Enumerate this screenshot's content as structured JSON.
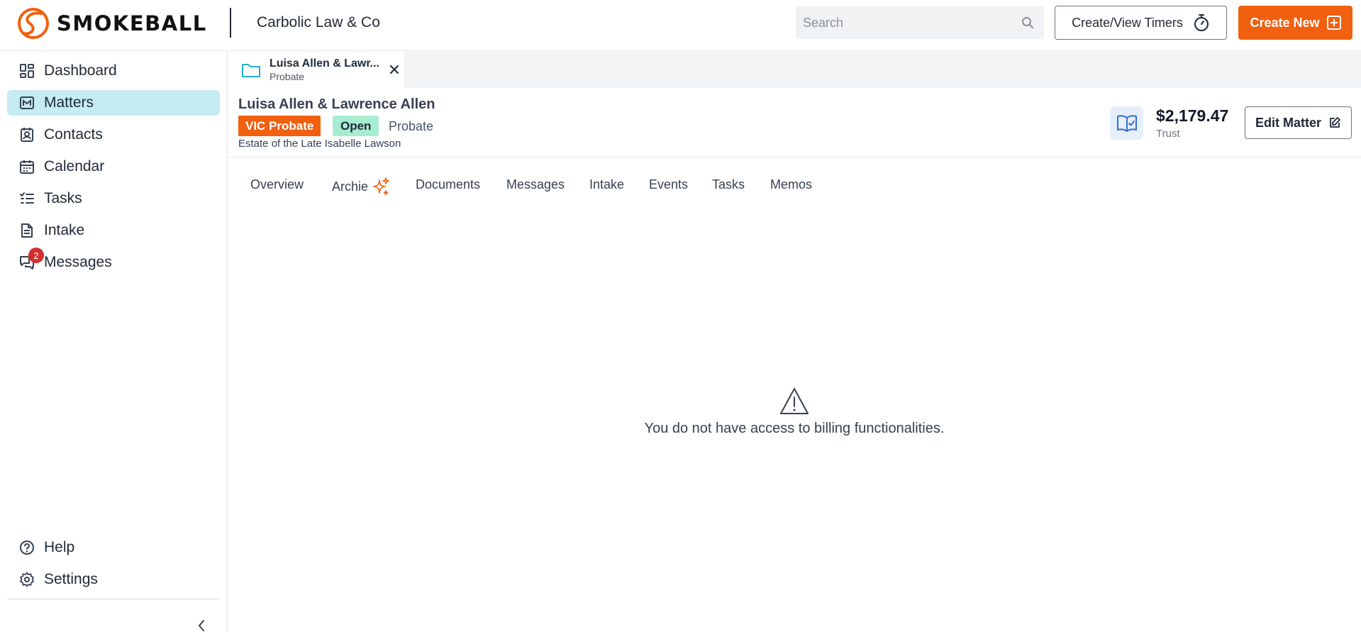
{
  "header": {
    "logo_text": "SMOKEBALL",
    "firm_name": "Carbolic Law & Co",
    "search_placeholder": "Search",
    "timers_label": "Create/View Timers",
    "create_label": "Create New"
  },
  "sidebar": {
    "items": [
      {
        "label": "Dashboard",
        "icon": "dashboard-icon"
      },
      {
        "label": "Matters",
        "icon": "matters-icon",
        "active": true
      },
      {
        "label": "Contacts",
        "icon": "contacts-icon"
      },
      {
        "label": "Calendar",
        "icon": "calendar-icon"
      },
      {
        "label": "Tasks",
        "icon": "tasks-icon"
      },
      {
        "label": "Intake",
        "icon": "intake-icon"
      },
      {
        "label": "Messages",
        "icon": "messages-icon",
        "badge": "2"
      }
    ],
    "bottom": [
      {
        "label": "Help",
        "icon": "help-icon"
      },
      {
        "label": "Settings",
        "icon": "gear-icon"
      }
    ]
  },
  "matter_tab": {
    "title": "Luisa Allen & Lawr...",
    "subtitle": "Probate"
  },
  "matter": {
    "title": "Luisa Allen & Lawrence Allen",
    "type": "VIC Probate",
    "status": "Open",
    "category": "Probate",
    "description": "Estate of the Late Isabelle Lawson",
    "trust_amount": "$2,179.47",
    "trust_label": "Trust",
    "edit_label": "Edit Matter"
  },
  "subtabs": [
    "Overview",
    "Archie",
    "Documents",
    "Messages",
    "Intake",
    "Events",
    "Tasks",
    "Memos"
  ],
  "notice": "You do not have access to billing functionalities.",
  "colors": {
    "brand_orange": "#f1600f",
    "active_nav_bg": "#c5ebf3",
    "open_status_bg": "#a7ecd1",
    "badge_red": "#d32f2f"
  }
}
